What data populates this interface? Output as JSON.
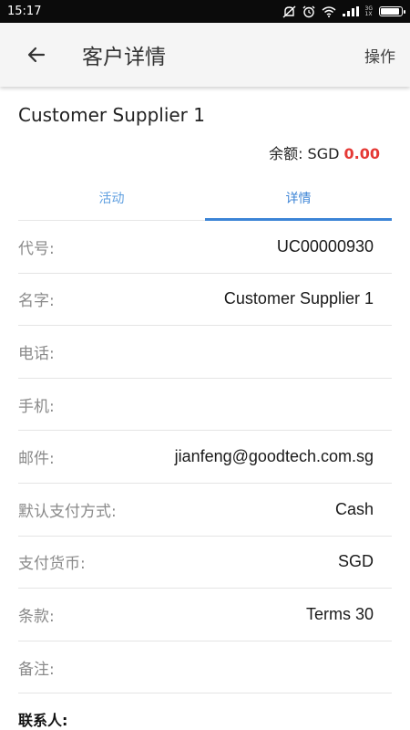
{
  "status_bar": {
    "time": "15:17",
    "network_top": "3G",
    "network_bottom": "1X",
    "battery_level": 0.9
  },
  "app_bar": {
    "back_icon": "arrow-left-icon",
    "title": "客户详情",
    "action_label": "操作"
  },
  "customer": {
    "name": "Customer Supplier 1",
    "balance_label": "余额: SGD ",
    "balance_amount": "0.00"
  },
  "tabs": [
    {
      "label": "活动",
      "active": false
    },
    {
      "label": "详情",
      "active": true
    }
  ],
  "details": [
    {
      "label": "代号:",
      "value": "UC00000930"
    },
    {
      "label": "名字:",
      "value": "Customer Supplier 1"
    },
    {
      "label": "电话:",
      "value": ""
    },
    {
      "label": "手机:",
      "value": ""
    },
    {
      "label": "邮件:",
      "value": "jianfeng@goodtech.com.sg"
    },
    {
      "label": "默认支付方式:",
      "value": "Cash"
    },
    {
      "label": "支付货币:",
      "value": "SGD"
    },
    {
      "label": "条款:",
      "value": "Terms 30"
    },
    {
      "label": "备注:",
      "value": ""
    }
  ],
  "contacts_heading": "联系人:",
  "colors": {
    "accent": "#3c84d6",
    "balance": "#e53935",
    "status_bar": "#0b0b0b"
  }
}
